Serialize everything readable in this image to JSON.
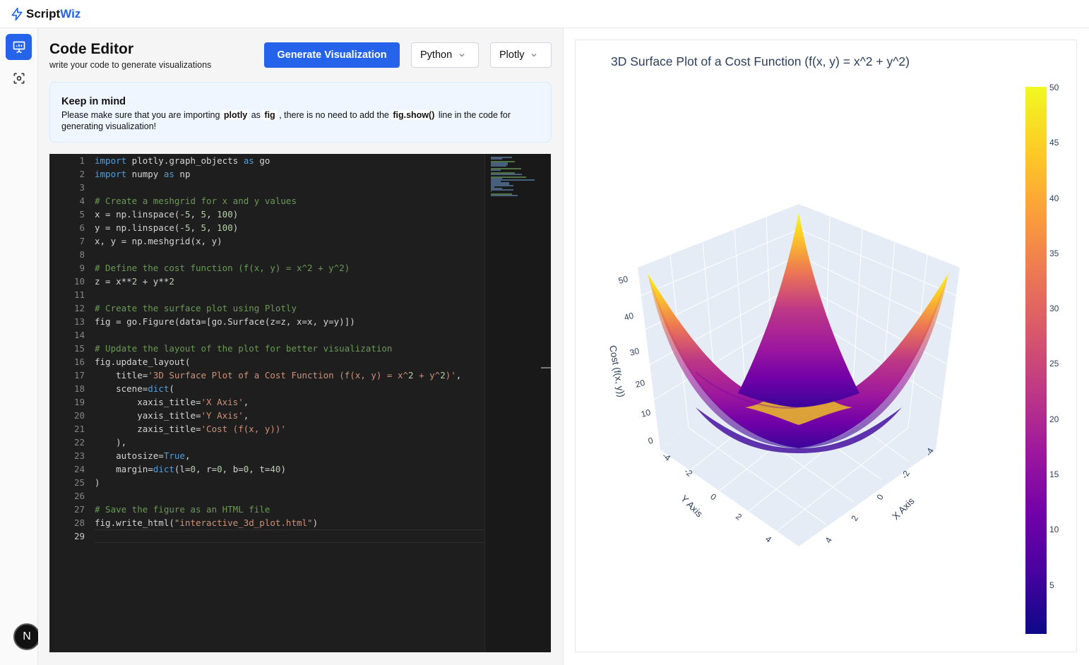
{
  "app": {
    "name_part1": "Script",
    "name_part2": "Wiz"
  },
  "header": {
    "title": "Code Editor",
    "subtitle": "write your code to generate visualizations",
    "generate_label": "Generate Visualization",
    "language": "Python",
    "library": "Plotly"
  },
  "notice": {
    "heading": "Keep in mind",
    "text_1": "Please make sure that you are importing",
    "code_1": "plotly",
    "text_2": "as",
    "code_2": "fig",
    "text_3": ", there is no need to add the",
    "code_3": "fig.show()",
    "text_4": "line in the code for generating visualization!"
  },
  "editor": {
    "line_numbers": [
      "1",
      "2",
      "3",
      "4",
      "5",
      "6",
      "7",
      "8",
      "9",
      "10",
      "11",
      "12",
      "13",
      "14",
      "15",
      "16",
      "17",
      "18",
      "19",
      "20",
      "21",
      "22",
      "23",
      "24",
      "25",
      "26",
      "27",
      "28",
      "29"
    ],
    "lines": [
      "import plotly.graph_objects as go",
      "import numpy as np",
      "",
      "# Create a meshgrid for x and y values",
      "x = np.linspace(-5, 5, 100)",
      "y = np.linspace(-5, 5, 100)",
      "x, y = np.meshgrid(x, y)",
      "",
      "# Define the cost function (f(x, y) = x^2 + y^2)",
      "z = x**2 + y**2",
      "",
      "# Create the surface plot using Plotly",
      "fig = go.Figure(data=[go.Surface(z=z, x=x, y=y)])",
      "",
      "# Update the layout of the plot for better visualization",
      "fig.update_layout(",
      "    title='3D Surface Plot of a Cost Function (f(x, y) = x^2 + y^2)',",
      "    scene=dict(",
      "        xaxis_title='X Axis',",
      "        yaxis_title='Y Axis',",
      "        zaxis_title='Cost (f(x, y))'",
      "    ),",
      "    autosize=True,",
      "    margin=dict(l=0, r=0, b=0, t=40)",
      ")",
      "",
      "# Save the figure as an HTML file",
      "fig.write_html(\"interactive_3d_plot.html\")",
      ""
    ]
  },
  "plot": {
    "title": "3D Surface Plot of a Cost Function (f(x, y) = x^2 + y^2)",
    "colorbar_ticks": [
      "50",
      "45",
      "40",
      "35",
      "30",
      "25",
      "20",
      "15",
      "10",
      "5"
    ],
    "z_ticks": [
      "50",
      "40",
      "30",
      "20",
      "10",
      "0"
    ],
    "y_ticks": [
      "-4",
      "-2",
      "0",
      "2",
      "4"
    ],
    "x_ticks": [
      "-4",
      "-2",
      "0",
      "2",
      "4"
    ],
    "xaxis_title": "X Axis",
    "yaxis_title": "Y Axis",
    "zaxis_title": "Cost (f(x, y))"
  },
  "chart_data": {
    "type": "surface",
    "title": "3D Surface Plot of a Cost Function (f(x, y) = x^2 + y^2)",
    "xlabel": "X Axis",
    "ylabel": "Y Axis",
    "zlabel": "Cost (f(x, y))",
    "xlim": [
      -5,
      5
    ],
    "ylim": [
      -5,
      5
    ],
    "zlim": [
      0,
      50
    ],
    "colorscale": "plasma",
    "colorbar_range": [
      0,
      50
    ],
    "colors": {
      "low": "#0d0887",
      "high": "#f0f921"
    }
  },
  "colors": {
    "accent": "#2563eb",
    "editor_bg": "#1e1e1e",
    "notice_bg": "#eff6ff"
  }
}
